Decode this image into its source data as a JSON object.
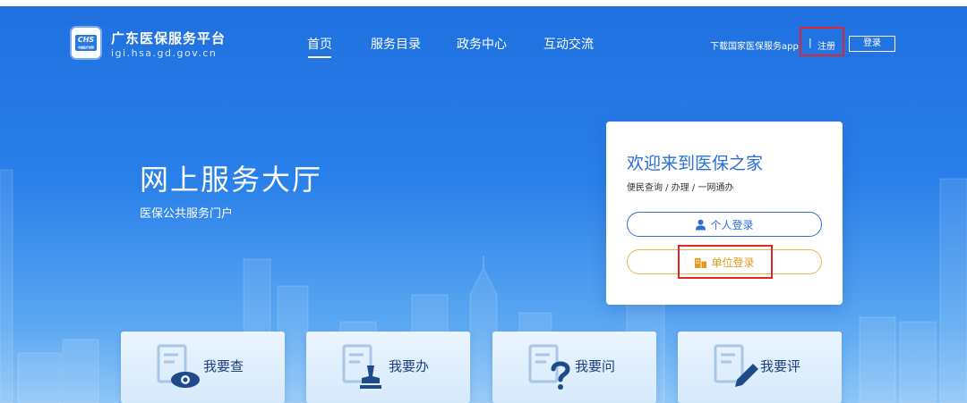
{
  "header": {
    "brand_title": "广东医保服务平台",
    "brand_domain": "igi.hsa.gd.gov.cn",
    "logo_text": "CHS",
    "logo_small": "中国医疗保障",
    "nav": [
      {
        "label": "首页",
        "active": true
      },
      {
        "label": "服务目录",
        "active": false
      },
      {
        "label": "政务中心",
        "active": false
      },
      {
        "label": "互动交流",
        "active": false
      }
    ],
    "app_link": "下载国家医保服务app",
    "separator": "|",
    "register": "注册",
    "login": "登录"
  },
  "hero": {
    "title": "网上服务大厅",
    "subtitle": "医保公共服务门户"
  },
  "welcome_card": {
    "title": "欢迎来到医保之家",
    "subtitle": "便民查询 / 办理 / 一网通办",
    "personal_login": "个人登录",
    "unit_login": "单位登录"
  },
  "tiles": [
    {
      "label": "我要查",
      "icon": "eye-icon"
    },
    {
      "label": "我要办",
      "icon": "stamp-icon"
    },
    {
      "label": "我要问",
      "icon": "question-icon"
    },
    {
      "label": "我要评",
      "icon": "pen-icon"
    }
  ],
  "colors": {
    "primary": "#2a78e4",
    "highlight_red": "#e0262b",
    "unit_orange": "#e39a1e",
    "card_title_blue": "#2a6fd8"
  }
}
